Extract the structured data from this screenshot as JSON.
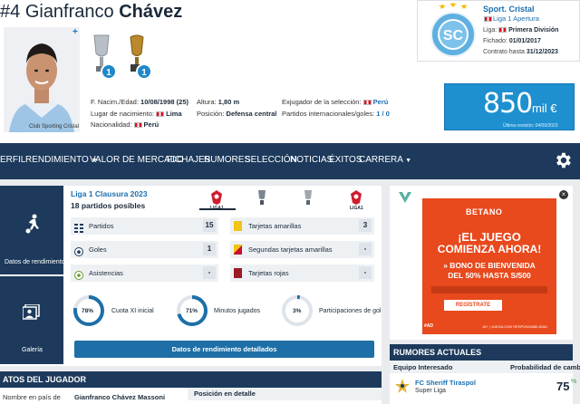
{
  "player": {
    "number": "#4",
    "first_name": "Gianfranco",
    "last_name": "Chávez",
    "photo_caption": "Club Sporting Cristal",
    "titles": [
      {
        "count": "1"
      },
      {
        "count": "1"
      }
    ]
  },
  "info": {
    "birth_label": "F. Nacim./Edad:",
    "birth_value": "10/08/1998 (25)",
    "place_label": "Lugar de nacimiento:",
    "place_value": "Lima",
    "nationality_label": "Nacionalidad:",
    "nationality_value": "Perú",
    "height_label": "Altura:",
    "height_value": "1,80 m",
    "position_label": "Posición:",
    "position_value": "Defensa central",
    "national_label": "Exjugador de la selección:",
    "national_value": "Perú",
    "caps_label": "Partidos internacionales/goles:",
    "caps_value": "1 / 0"
  },
  "club": {
    "name": "Sport. Cristal",
    "league": "Liga 1 Apertura",
    "liga_label": "Liga:",
    "liga_value": "Primera División",
    "signed_label": "Fichado:",
    "signed_value": "01/01/2017",
    "contract_label": "Contrato hasta",
    "contract_value": "31/12/2023"
  },
  "market_value": {
    "amount": "850",
    "unit": "mil €",
    "last_revision": "Última revisión: 04/09/2023"
  },
  "nav": {
    "items": [
      "ERFIL",
      "RENDIMIENTO",
      "VALOR DE MERCADO",
      "FICHAJES",
      "RUMORES",
      "SELECCIÓN",
      "NOTICIAS",
      "ÉXITOS",
      "CARRERA"
    ]
  },
  "performance": {
    "side_tabs": [
      "Datos de rendimiento",
      "Galería"
    ],
    "competition": "Liga 1 Clausura 2023",
    "games_possible": "18 partidos posibles",
    "comp_tabs": [
      "LIGA1",
      "",
      "",
      "LIGA1"
    ],
    "stats_left": [
      {
        "label": "Partidos",
        "value": "15"
      },
      {
        "label": "Goles",
        "value": "1"
      },
      {
        "label": "Asistencias",
        "value": "-"
      }
    ],
    "stats_right": [
      {
        "label": "Tarjetas amarillas",
        "value": "3"
      },
      {
        "label": "Segundas tarjetas amarillas",
        "value": "-"
      },
      {
        "label": "Tarjetas rojas",
        "value": "-"
      }
    ],
    "donuts": [
      {
        "pct": "78%",
        "value": 0.78,
        "label": "Cuota XI inicial"
      },
      {
        "pct": "71%",
        "value": 0.71,
        "label": "Minutos jugados"
      },
      {
        "pct": "3%",
        "value": 0.03,
        "label": "Participaciones de gol"
      }
    ],
    "detail_button": "Datos de rendimiento detallados"
  },
  "player_data": {
    "title": "ATOS DEL JUGADOR",
    "row_label": "Nombre en país de",
    "row_value": "Gianfranco Chávez Massoni",
    "position_detail": "Posición en detalle"
  },
  "ad": {
    "brand": "BETANO",
    "line1": "¡EL JUEGO",
    "line2": "COMIENZA AHORA!",
    "line3": "» BONO DE BIENVENIDA",
    "line4": "DEL 50% HASTA S/500",
    "cta": "REGÍSTRATE",
    "footer": "18+ | JUEGA CON RESPONSABILIDAD",
    "tag": "#AD",
    "colors": {
      "bg": "#e8491d",
      "text": "#ffffff"
    }
  },
  "rumors": {
    "title": "RUMORES ACTUALES",
    "col_team": "Equipo Interesado",
    "col_prob": "Probabilidad de cambio",
    "team": "FC Sheriff Tiraspol",
    "league": "Super Liga",
    "probability": "75"
  }
}
